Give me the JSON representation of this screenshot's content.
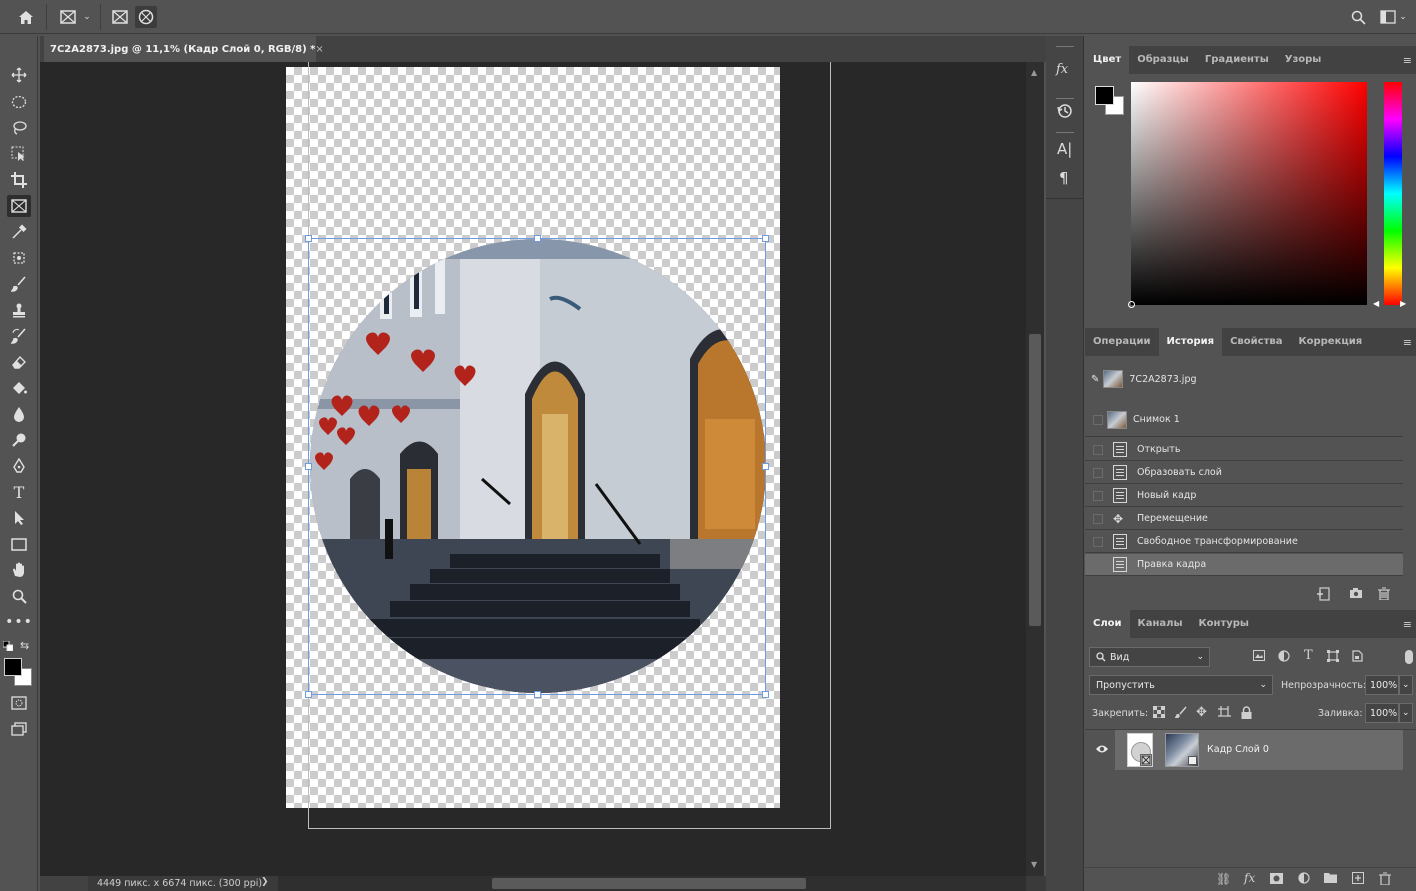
{
  "document": {
    "tab_title": "7C2A2873.jpg @ 11,1% (Кадр Слой 0, RGB/8) *",
    "close_glyph": "×"
  },
  "status": {
    "dimensions": "4449 пикс. x 6674 пикс. (300 ppi)",
    "arrow": "❯"
  },
  "color_panel": {
    "tabs": [
      "Цвет",
      "Образцы",
      "Градиенты",
      "Узоры"
    ],
    "foreground": "#000000",
    "background": "#ffffff",
    "hue_color": "#ff0000"
  },
  "history_panel": {
    "tabs": [
      "Операции",
      "История",
      "Свойства",
      "Коррекция"
    ],
    "snapshots": [
      "7C2A2873.jpg",
      "Снимок 1"
    ],
    "steps": [
      "Открыть",
      "Образовать слой",
      "Новый кадр",
      "Перемещение",
      "Свободное трансформирование",
      "Правка кадра"
    ],
    "selected_step": "Правка кадра"
  },
  "layers_panel": {
    "tabs": [
      "Слои",
      "Каналы",
      "Контуры"
    ],
    "filter_label": "Вид",
    "blend_mode": "Пропустить",
    "opacity_label": "Непрозрачность:",
    "opacity_value": "100%",
    "lock_label": "Закрепить:",
    "fill_label": "Заливка:",
    "fill_value": "100%",
    "layers": [
      {
        "name": "Кадр Слой 0",
        "visible": true
      }
    ]
  },
  "icons": {
    "type_tool": "T",
    "fx": "fx",
    "paragraph": "¶",
    "char": "A|",
    "menu": "≡",
    "collapse": "«",
    "expand": "»"
  }
}
